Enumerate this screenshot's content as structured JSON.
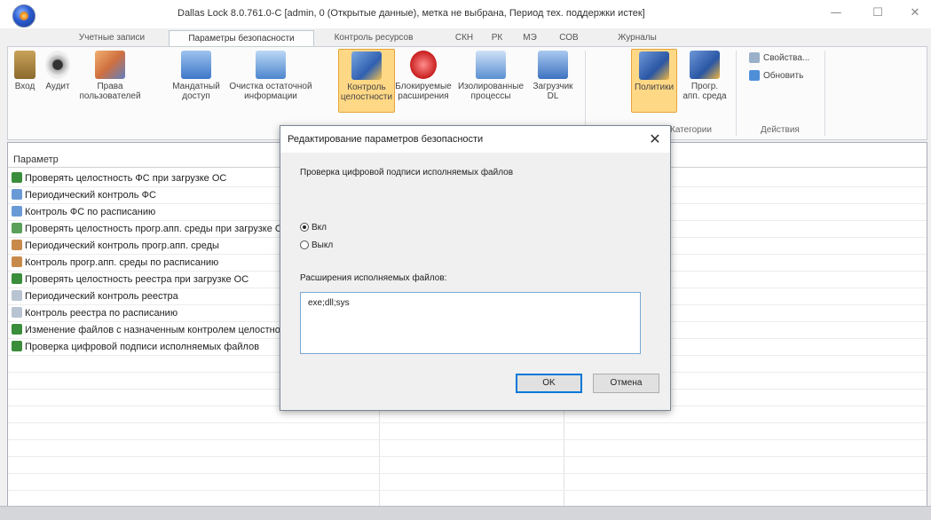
{
  "window": {
    "title": "Dallas Lock 8.0.761.0-C [admin, 0 (Открытые данные), метка не выбрана, Период тех. поддержки истек]",
    "minimize": "—",
    "maximize": "☐",
    "close": "✕"
  },
  "tabs": [
    "Учетные записи",
    "Параметры безопасности",
    "Контроль ресурсов",
    "СКН",
    "РК",
    "МЭ",
    "СОВ",
    "Журналы"
  ],
  "ribbon": {
    "buttons": [
      {
        "line1": "Вход",
        "line2": ""
      },
      {
        "line1": "Аудит",
        "line2": ""
      },
      {
        "line1": "Права",
        "line2": "пользователей"
      },
      {
        "line1": "Мандатный",
        "line2": "доступ"
      },
      {
        "line1": "Очистка остаточной",
        "line2": "информации"
      },
      {
        "line1": "Контроль",
        "line2": "целостности"
      },
      {
        "line1": "Блокируемые",
        "line2": "расширения"
      },
      {
        "line1": "Изолированные",
        "line2": "процессы"
      },
      {
        "line1": "Загрузчик",
        "line2": "DL"
      },
      {
        "line1": "Политики",
        "line2": ""
      },
      {
        "line1": "Прогр.",
        "line2": "апп. среда"
      }
    ],
    "group_categories": "Категории",
    "group_actions": "Действия",
    "action_properties": "Свойства...",
    "action_refresh": "Обновить"
  },
  "table": {
    "header": "Параметр",
    "rows": [
      "Проверять целостность ФС при загрузке ОС",
      "Периодический контроль ФС",
      "Контроль ФС по расписанию",
      "Проверять целостность прогр.апп. среды при загрузке ОС",
      "Периодический контроль прогр.апп. среды",
      "Контроль прогр.апп. среды по расписанию",
      "Проверять целостность реестра при загрузке ОС",
      "Периодический контроль реестра",
      "Контроль реестра по расписанию",
      "Изменение файлов с назначенным контролем целостности",
      "Проверка цифровой подписи исполняемых файлов"
    ]
  },
  "dialog": {
    "title": "Редактирование параметров безопасности",
    "close": "✕",
    "param_name": "Проверка цифровой подписи исполняемых файлов",
    "radio_on": "Вкл",
    "radio_off": "Выкл",
    "selected": "Вкл",
    "ext_label": "Расширения исполняемых файлов:",
    "ext_value": "exe;dll;sys",
    "ok": "OK",
    "cancel": "Отмена"
  },
  "colors": {
    "highlight": "#ffd886",
    "accent_border": "#0078d7"
  }
}
